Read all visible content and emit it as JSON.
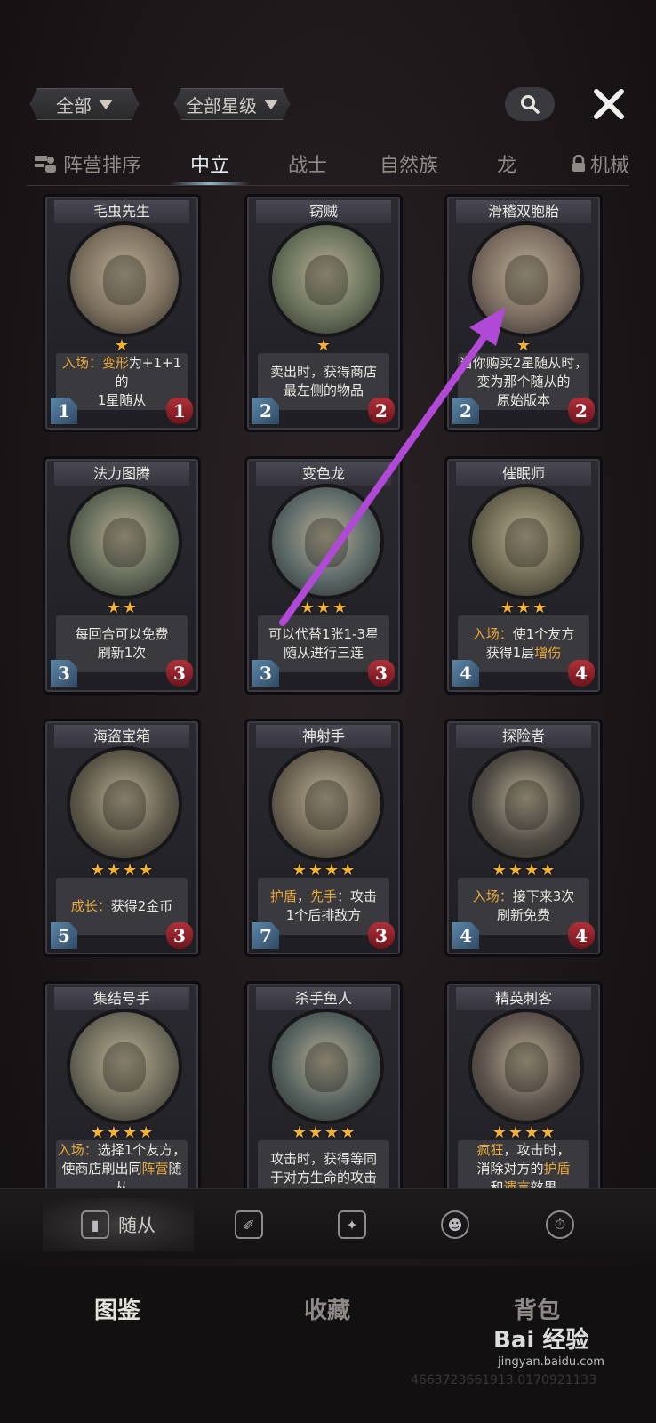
{
  "filters": {
    "faction": "全部",
    "star": "全部星级"
  },
  "tabs": [
    {
      "label": "阵营排序"
    },
    {
      "label": "中立"
    },
    {
      "label": "战士"
    },
    {
      "label": "自然族"
    },
    {
      "label": "龙"
    },
    {
      "label": "机械"
    }
  ],
  "cards": [
    {
      "name": "毛虫先生",
      "stars": 1,
      "atk": "1",
      "hp": "1",
      "art": "#7b6f5e",
      "lines": [
        [
          {
            "t": "入场：",
            "kw": true
          },
          {
            "t": "变形",
            "kw": true
          },
          {
            "t": "为+1+1的",
            "kw": false
          }
        ],
        [
          {
            "t": "1星随从",
            "kw": false
          }
        ]
      ]
    },
    {
      "name": "窃贼",
      "stars": 1,
      "atk": "2",
      "hp": "2",
      "art": "#66705a",
      "lines": [
        [
          {
            "t": "卖出时，获得商店",
            "kw": false
          }
        ],
        [
          {
            "t": "最左侧的物品",
            "kw": false
          }
        ]
      ]
    },
    {
      "name": "滑稽双胞胎",
      "stars": 1,
      "atk": "2",
      "hp": "2",
      "art": "#7a6b60",
      "lines": [
        [
          {
            "t": "当你购买2星随从时，",
            "kw": false
          }
        ],
        [
          {
            "t": "变为那个随从的",
            "kw": false
          }
        ],
        [
          {
            "t": "原始版本",
            "kw": false
          }
        ]
      ]
    },
    {
      "name": "法力图腾",
      "stars": 2,
      "atk": "3",
      "hp": "3",
      "art": "#5f6857",
      "lines": [
        [
          {
            "t": "每回合可以免费",
            "kw": false
          }
        ],
        [
          {
            "t": "刷新1次",
            "kw": false
          }
        ]
      ]
    },
    {
      "name": "变色龙",
      "stars": 3,
      "atk": "3",
      "hp": "3",
      "art": "#5a6868",
      "lines": [
        [
          {
            "t": "可以代替1张1-3星",
            "kw": false
          }
        ],
        [
          {
            "t": "随从进行三连",
            "kw": false
          }
        ]
      ]
    },
    {
      "name": "催眠师",
      "stars": 3,
      "atk": "4",
      "hp": "4",
      "art": "#6b664f",
      "lines": [
        [
          {
            "t": "入场：",
            "kw": true
          },
          {
            "t": "使1个友方",
            "kw": false
          }
        ],
        [
          {
            "t": "获得1层",
            "kw": false
          },
          {
            "t": "增伤",
            "kw": true
          }
        ]
      ]
    },
    {
      "name": "海盗宝箱",
      "stars": 4,
      "atk": "5",
      "hp": "3",
      "art": "#5d5849",
      "lines": [
        [
          {
            "t": "成长：",
            "kw": true
          },
          {
            "t": "获得2金币",
            "kw": false
          }
        ]
      ]
    },
    {
      "name": "神射手",
      "stars": 4,
      "atk": "7",
      "hp": "3",
      "art": "#6a6151",
      "lines": [
        [
          {
            "t": "护盾",
            "kw": true
          },
          {
            "t": "，",
            "kw": false
          },
          {
            "t": "先手",
            "kw": true
          },
          {
            "t": "：攻击",
            "kw": false
          }
        ],
        [
          {
            "t": "1个后排敌方",
            "kw": false
          }
        ]
      ]
    },
    {
      "name": "探险者",
      "stars": 4,
      "atk": "4",
      "hp": "4",
      "art": "#4e4a44",
      "lines": [
        [
          {
            "t": "入场：",
            "kw": true
          },
          {
            "t": "接下来3次",
            "kw": false
          }
        ],
        [
          {
            "t": "刷新免费",
            "kw": false
          }
        ]
      ]
    },
    {
      "name": "集结号手",
      "stars": 4,
      "atk": "",
      "hp": "",
      "art": "#6c6a5a",
      "lines": [
        [
          {
            "t": "入场：",
            "kw": true
          },
          {
            "t": "选择1个友方，",
            "kw": false
          }
        ],
        [
          {
            "t": "使商店刷出同",
            "kw": false
          },
          {
            "t": "阵营",
            "kw": true
          },
          {
            "t": "随从",
            "kw": false
          }
        ]
      ]
    },
    {
      "name": "杀手鱼人",
      "stars": 4,
      "atk": "",
      "hp": "",
      "art": "#53605e",
      "lines": [
        [
          {
            "t": "攻击时，获得等同",
            "kw": false
          }
        ],
        [
          {
            "t": "于对方生命的攻击",
            "kw": false
          }
        ]
      ]
    },
    {
      "name": "精英刺客",
      "stars": 4,
      "atk": "",
      "hp": "",
      "art": "#5d524c",
      "lines": [
        [
          {
            "t": "疯狂",
            "kw": true
          },
          {
            "t": "，攻击时，",
            "kw": false
          }
        ],
        [
          {
            "t": "消除对方的",
            "kw": false
          },
          {
            "t": "护盾",
            "kw": true
          }
        ],
        [
          {
            "t": "和",
            "kw": false
          },
          {
            "t": "遗言",
            "kw": true
          },
          {
            "t": "效果",
            "kw": false
          }
        ]
      ]
    }
  ],
  "subnav": {
    "active_label": "随从"
  },
  "bottomnav": [
    {
      "label": "图鉴"
    },
    {
      "label": "收藏"
    },
    {
      "label": "背包"
    }
  ],
  "watermark": {
    "brand": "Bai 经验",
    "url": "jingyan.baidu.com",
    "code": "4663723661913.0170921133"
  },
  "colors": {
    "accent": "#f2b233",
    "keyword": "#e9a93a",
    "annotation": "#b04ad6"
  }
}
